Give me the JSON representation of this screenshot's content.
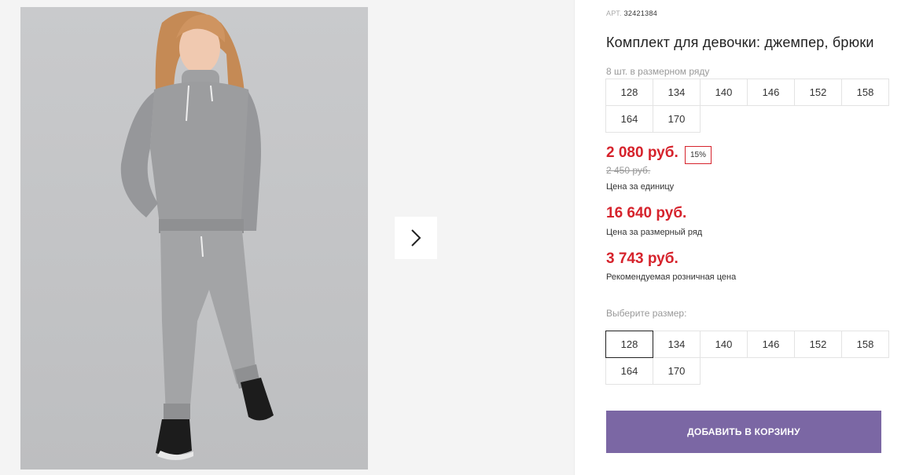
{
  "gallery": {
    "next_icon": "chevron-right-icon",
    "colors": {
      "background": "#f4f4f4",
      "photo_background": "#c4c5c7"
    }
  },
  "product": {
    "art_label": "АРТ.",
    "art_number": "32421384",
    "title": "Комплект для девочки: джемпер, брюки",
    "pack_info": "8 шт. в размерном ряду",
    "pack_sizes": [
      "128",
      "134",
      "140",
      "146",
      "152",
      "158",
      "164",
      "170"
    ],
    "price": "2 080 руб.",
    "discount": "15%",
    "old_price": "2 450 руб.",
    "price_caption": "Цена за единицу",
    "pack_price": "16 640 руб.",
    "pack_price_caption": "Цена за размерный ряд",
    "retail_price": "3 743 руб.",
    "retail_price_caption": "Рекомендуемая розничная цена",
    "choose_size_label": "Выберите размер:",
    "sizes": [
      "128",
      "134",
      "140",
      "146",
      "152",
      "158",
      "164",
      "170"
    ],
    "selected_size": "128",
    "add_to_cart_label": "ДОБАВИТЬ В КОРЗИНУ"
  },
  "colors": {
    "accent_red": "#d6232c",
    "button_purple": "#7b67a4",
    "border": "#e3e3e3"
  }
}
